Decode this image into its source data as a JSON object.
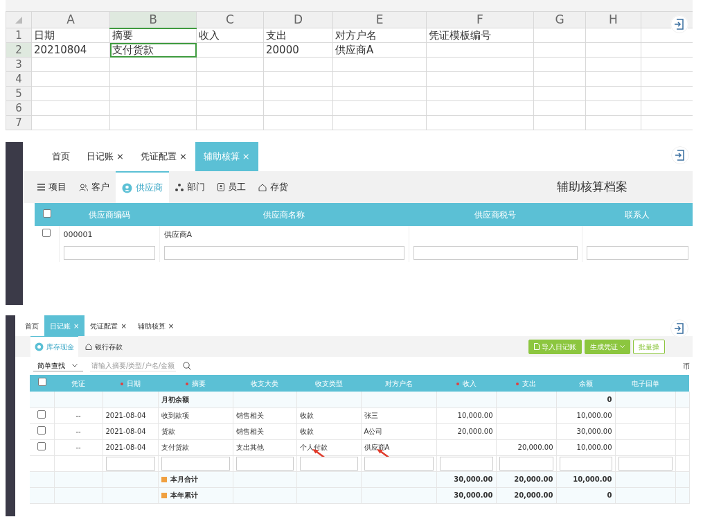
{
  "spreadsheet": {
    "columns": [
      {
        "label": "A",
        "selected": false
      },
      {
        "label": "B",
        "selected": true
      },
      {
        "label": "C",
        "selected": false
      },
      {
        "label": "D",
        "selected": false
      },
      {
        "label": "E",
        "selected": false
      },
      {
        "label": "F",
        "selected": false
      },
      {
        "label": "G",
        "selected": false
      },
      {
        "label": "H",
        "selected": false
      }
    ],
    "rows": [
      {
        "number": "1",
        "selected": false,
        "cells": [
          {
            "text": "日期",
            "selected": false
          },
          {
            "text": "摘要",
            "selected": false
          },
          {
            "text": "收入",
            "selected": false
          },
          {
            "text": "支出",
            "selected": false
          },
          {
            "text": "对方户名",
            "selected": false
          },
          {
            "text": "凭证模板编号",
            "selected": false
          },
          {
            "selected": false
          },
          {
            "selected": false
          }
        ]
      },
      {
        "number": "2",
        "selected": true,
        "cells": [
          {
            "text": "20210804",
            "selected": false
          },
          {
            "text": "支付货款",
            "selected": true
          },
          {
            "selected": false
          },
          {
            "text": "20000",
            "selected": false
          },
          {
            "text": "供应商A",
            "selected": false
          },
          {
            "selected": false
          },
          {
            "selected": false
          },
          {
            "selected": false
          }
        ]
      },
      {
        "number": "3",
        "selected": false
      },
      {
        "number": "4",
        "selected": false
      },
      {
        "number": "5",
        "selected": false
      },
      {
        "number": "6",
        "selected": false
      },
      {
        "number": "7",
        "selected": false
      }
    ]
  },
  "auxiliary_panel": {
    "tabs": [
      {
        "label": "首页",
        "closable": false,
        "selected": false
      },
      {
        "label": "日记账",
        "closable": true,
        "selected": false
      },
      {
        "label": "凭证配置",
        "closable": true,
        "selected": false
      },
      {
        "label": "辅助核算",
        "closable": true,
        "selected": true
      }
    ],
    "close_mark": "×",
    "categories": [
      {
        "label": "项目",
        "selected": false
      },
      {
        "label": "客户",
        "selected": false
      },
      {
        "label": "供应商",
        "selected": true
      },
      {
        "label": "部门",
        "selected": false
      },
      {
        "label": "员工",
        "selected": false
      },
      {
        "label": "存货",
        "selected": false
      }
    ],
    "title": "辅助核算档案",
    "table": {
      "all_checked": false,
      "columns": [
        "供应商编码",
        "供应商名称",
        "供应商税号",
        "联系人"
      ],
      "rows": [
        {
          "checked": false,
          "cells": [
            "000001",
            "供应商A"
          ]
        }
      ]
    }
  },
  "journal_panel": {
    "tabs": [
      {
        "label": "首页",
        "closable": false,
        "selected": false
      },
      {
        "label": "日记账",
        "closable": true,
        "selected": true
      },
      {
        "label": "凭证配置",
        "closable": true,
        "selected": false
      },
      {
        "label": "辅助核算",
        "closable": true,
        "selected": false
      }
    ],
    "close_mark": "×",
    "account_tabs": [
      {
        "label": "库存现金",
        "selected": true
      },
      {
        "label": "银行存款",
        "selected": false
      }
    ],
    "buttons": [
      {
        "label": "导入日记账",
        "kind": "import"
      },
      {
        "label": "生成凭证",
        "kind": "dropdown"
      },
      {
        "label": "批量操",
        "kind": "outline"
      }
    ],
    "search": {
      "mode": "简单查找",
      "placeholder": "请输入摘要/类型/户名/金额"
    },
    "currency_label": "币",
    "all_checked": false,
    "columns": [
      {
        "label": "凭证",
        "required": false
      },
      {
        "label": "日期",
        "required": true
      },
      {
        "label": "摘要",
        "required": true
      },
      {
        "label": "收支大类",
        "required": false
      },
      {
        "label": "收支类型",
        "required": false
      },
      {
        "label": "对方户名",
        "required": false
      },
      {
        "label": "收入",
        "required": true
      },
      {
        "label": "支出",
        "required": true
      },
      {
        "label": "余额",
        "required": false
      },
      {
        "label": "电子回单",
        "required": false
      }
    ],
    "opening": {
      "label": "月初余额",
      "balance": "0"
    },
    "rows": [
      {
        "checked": false,
        "voucher": "--",
        "date": "2021-08-04",
        "summary": "收到款项",
        "category": "销售相关",
        "type": "收款",
        "counterparty": "张三",
        "income": "10,000.00",
        "balance": "10,000.00"
      },
      {
        "checked": false,
        "voucher": "--",
        "date": "2021-08-04",
        "summary": "货款",
        "category": "销售相关",
        "type": "收款",
        "counterparty": "A公司",
        "income": "20,000.00",
        "balance": "30,000.00"
      },
      {
        "checked": false,
        "voucher": "--",
        "date": "2021-08-04",
        "summary": "支付货款",
        "category": "支出其他",
        "type": "个人付款",
        "counterparty": "供应商A",
        "expense": "20,000.00",
        "balance": "10,000.00",
        "annotated": true
      }
    ],
    "totals": [
      {
        "label": "本月合计",
        "income": "30,000.00",
        "expense": "20,000.00",
        "balance": "10,000.00"
      },
      {
        "label": "本年累计",
        "income": "30,000.00",
        "expense": "20,000.00",
        "balance": "0"
      }
    ]
  }
}
